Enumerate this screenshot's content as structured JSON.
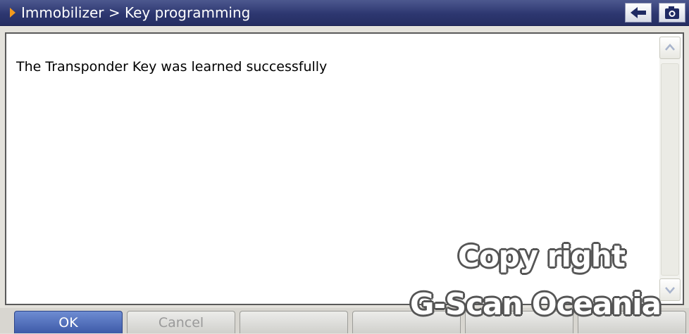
{
  "window": {
    "breadcrumb": "Immobilizer > Key programming",
    "back_icon": "back-arrow-icon",
    "camera_icon": "camera-icon"
  },
  "content": {
    "message": "The Transponder Key was learned successfully"
  },
  "watermark": {
    "line1": "Copy right",
    "line2": "G-Scan Oceania"
  },
  "footer": {
    "buttons": [
      {
        "label": "OK"
      },
      {
        "label": "Cancel"
      },
      {
        "label": ""
      },
      {
        "label": ""
      },
      {
        "label": ""
      },
      {
        "label": ""
      }
    ]
  },
  "colors": {
    "titlebar": "#2d3770",
    "accent_arrow": "#f39a1e",
    "primary_button": "#3d5aa8"
  }
}
